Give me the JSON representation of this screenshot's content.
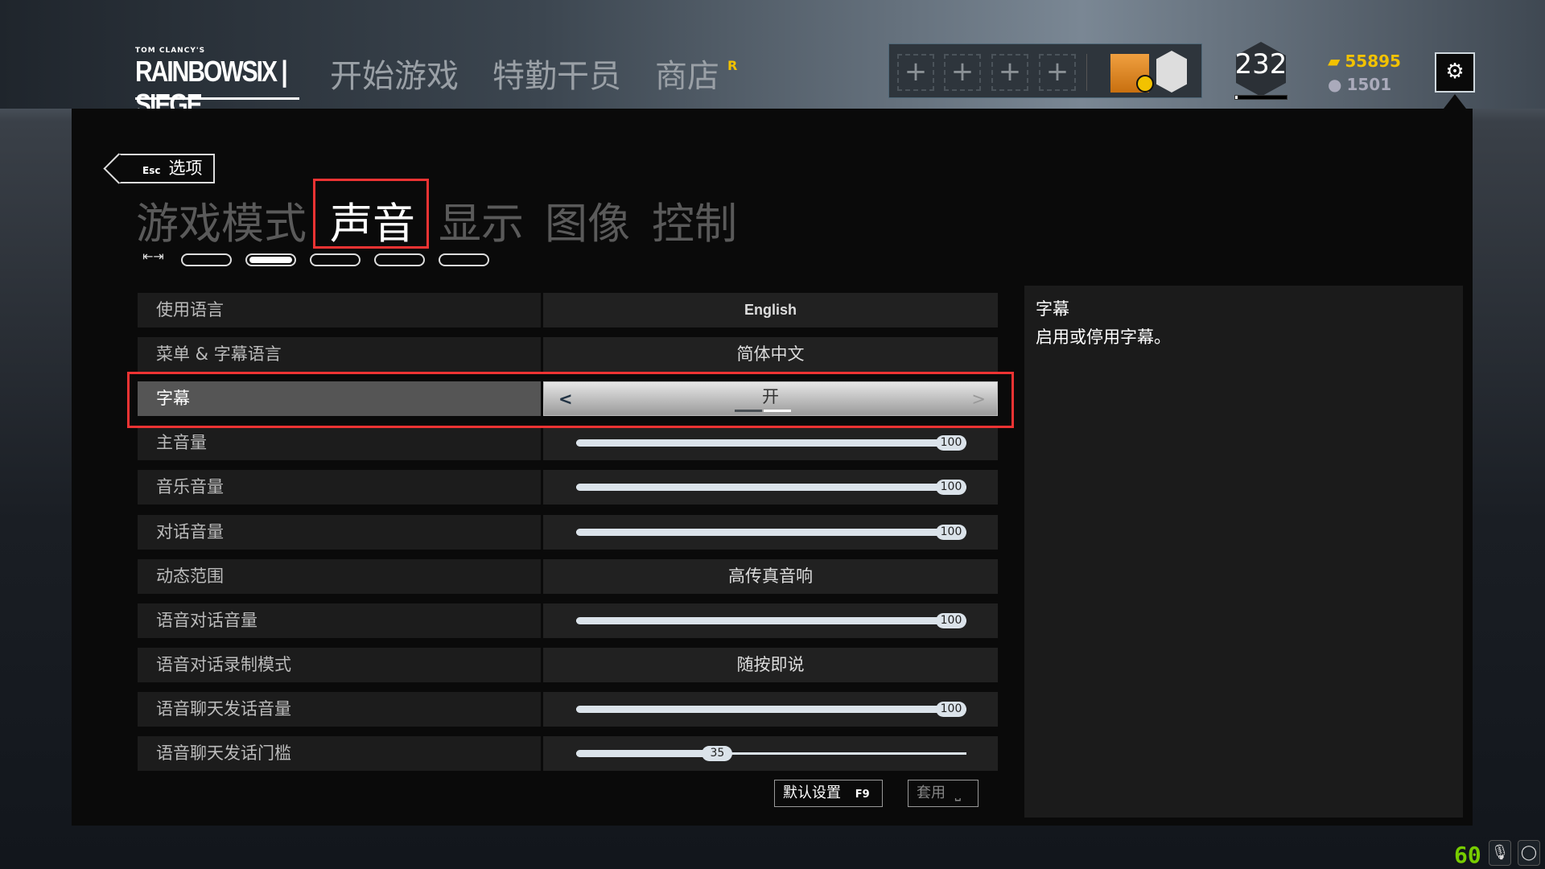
{
  "header": {
    "logo_small": "TOM CLANCY'S",
    "logo_text": "RAINBOWSIX | SIEGE",
    "nav": [
      "开始游戏",
      "特勤干员",
      "商店"
    ],
    "store_badge": "R",
    "level": "232",
    "level_progress": 0.05,
    "renown": "55895",
    "r6_credits": "1501",
    "colors": {
      "renown": "#f2c200",
      "highlight": "#e33333",
      "fps": "#77cc00"
    }
  },
  "back": {
    "key": "Esc",
    "label": "选项"
  },
  "tabs": [
    {
      "label": "游戏模式"
    },
    {
      "label": "声音",
      "active": true
    },
    {
      "label": "显示"
    },
    {
      "label": "图像"
    },
    {
      "label": "控制"
    }
  ],
  "page_indicator": {
    "count": 5,
    "active": 1
  },
  "settings": [
    {
      "label": "使用语言",
      "value": "English"
    },
    {
      "label": "菜单 & 字幕语言",
      "value": "简体中文"
    },
    {
      "label": "字幕",
      "value": "开",
      "selected": true,
      "type": "toggle"
    },
    {
      "label": "主音量",
      "slider": 100
    },
    {
      "label": "音乐音量",
      "slider": 100
    },
    {
      "label": "对话音量",
      "slider": 100
    },
    {
      "label": "动态范围",
      "value": "高传真音响"
    },
    {
      "label": "语音对话音量",
      "slider": 100
    },
    {
      "label": "语音对话录制模式",
      "value": "随按即说"
    },
    {
      "label": "语音聊天发话音量",
      "slider": 100
    },
    {
      "label": "语音聊天发话门槛",
      "slider": 35
    }
  ],
  "info": {
    "title": "字幕",
    "description": "启用或停用字幕。"
  },
  "buttons": {
    "default_label": "默认设置",
    "default_key": "F9",
    "apply_label": "套用",
    "apply_key": "⎵"
  },
  "status": {
    "fps": "60"
  }
}
